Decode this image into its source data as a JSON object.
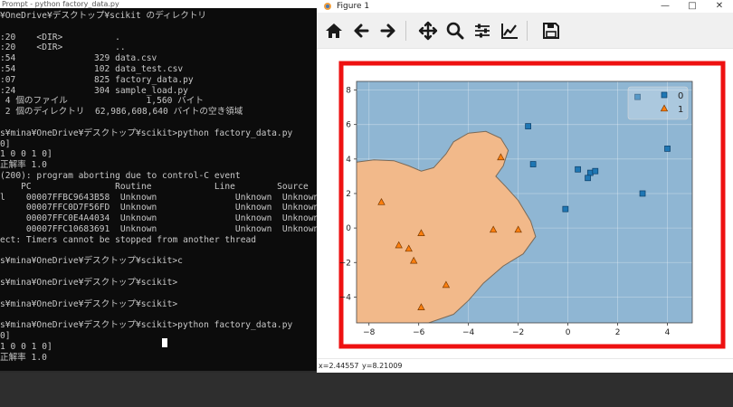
{
  "console": {
    "title": "Prompt - python  factory_data.py",
    "lines": [
      "¥OneDrive¥デスクトップ¥scikit のディレクトリ",
      "",
      ":20    <DIR>          .",
      ":20    <DIR>          ..",
      ":54               329 data.csv",
      ":54               102 data_test.csv",
      ":07               825 factory_data.py",
      ":24               304 sample_load.py",
      " 4 個のファイル               1,560 バイト",
      " 2 個のディレクトリ  62,986,608,640 バイトの空き領域",
      "",
      "s¥mina¥OneDrive¥デスクトップ¥scikit>python factory_data.py",
      "0]",
      "1 0 0 1 0]",
      "正解率 1.0",
      "(200): program aborting due to control-C event",
      "    PC                Routine            Line        Source",
      "l    00007FFBC9643B58  Unknown               Unknown  Unknown",
      "     00007FFC0D7F56FD  Unknown               Unknown  Unknown",
      "     00007FFC0E4A4034  Unknown               Unknown  Unknown",
      "     00007FFC10683691  Unknown               Unknown  Unknown",
      "ect: Timers cannot be stopped from another thread",
      "",
      "s¥mina¥OneDrive¥デスクトップ¥scikit>c",
      "",
      "s¥mina¥OneDrive¥デスクトップ¥scikit>",
      "",
      "s¥mina¥OneDrive¥デスクトップ¥scikit>",
      "",
      "s¥mina¥OneDrive¥デスクトップ¥scikit>python factory_data.py",
      "0]",
      "1 0 0 1 0]",
      "正解率 1.0"
    ]
  },
  "figure": {
    "title": "Figure 1",
    "window_buttons": {
      "minimize": "—",
      "maximize": "□",
      "close": "✕"
    },
    "toolbar": [
      {
        "name": "home",
        "icon": "home-icon"
      },
      {
        "name": "back",
        "icon": "arrow-left-icon"
      },
      {
        "name": "forward",
        "icon": "arrow-right-icon"
      },
      {
        "name": "pan",
        "icon": "move-icon"
      },
      {
        "name": "zoom",
        "icon": "zoom-icon"
      },
      {
        "name": "subplots",
        "icon": "sliders-icon"
      },
      {
        "name": "edit-axes",
        "icon": "line-chart-icon"
      },
      {
        "name": "save",
        "icon": "save-icon"
      }
    ],
    "status": {
      "x": "x=2.44557",
      "y": "y=8.21009"
    }
  },
  "highlight_color": "#ee1111",
  "chart_data": {
    "type": "scatter",
    "plot_kind": "decision regions",
    "xlim": [
      -8.5,
      5.0
    ],
    "ylim": [
      -5.5,
      8.5
    ],
    "xticks": [
      -8,
      -6,
      -4,
      -2,
      0,
      2,
      4
    ],
    "yticks": [
      -4,
      -2,
      0,
      2,
      4,
      6,
      8
    ],
    "grid": true,
    "legend_position": "top-right",
    "region_colors": {
      "0": "#8fb6d3",
      "1": "#f2b98a"
    },
    "series": [
      {
        "name": "0",
        "marker": "square",
        "color": "#1f77b4",
        "points": [
          [
            -1.6,
            5.9
          ],
          [
            -1.4,
            3.7
          ],
          [
            0.4,
            3.4
          ],
          [
            0.9,
            3.2
          ],
          [
            1.1,
            3.3
          ],
          [
            0.8,
            2.9
          ],
          [
            2.8,
            7.6
          ],
          [
            4.0,
            4.6
          ],
          [
            3.0,
            2.0
          ],
          [
            -0.1,
            1.1
          ]
        ]
      },
      {
        "name": "1",
        "marker": "triangle",
        "color": "#ff7f0e",
        "points": [
          [
            -7.5,
            1.5
          ],
          [
            -6.8,
            -1.0
          ],
          [
            -6.4,
            -1.2
          ],
          [
            -6.2,
            -1.9
          ],
          [
            -5.9,
            -0.3
          ],
          [
            -4.9,
            -3.3
          ],
          [
            -5.9,
            -4.6
          ],
          [
            -3.0,
            -0.1
          ],
          [
            -2.7,
            4.1
          ],
          [
            -2.0,
            -0.1
          ]
        ]
      }
    ]
  }
}
